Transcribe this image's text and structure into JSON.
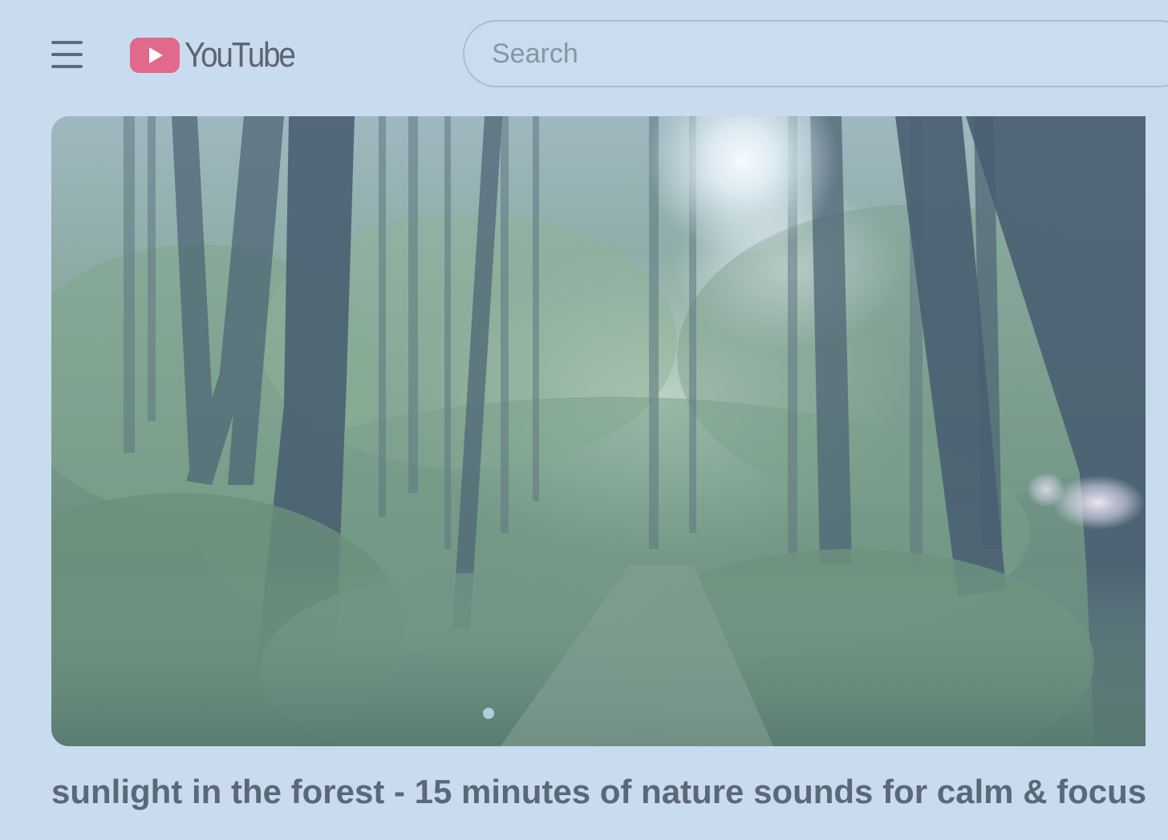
{
  "header": {
    "logo_text": "YouTube",
    "logo_color": "#e0698c",
    "menu_icon": "hamburger-menu-icon",
    "search": {
      "placeholder": "Search",
      "value": ""
    }
  },
  "video": {
    "thumbnail_description_icon": "video-thumbnail",
    "title": "sunlight in the forest - 15 minutes of nature sounds for calm & focus"
  },
  "colors": {
    "background": "#c9dbee",
    "text": "#5a6879",
    "brand": "#e0698c"
  }
}
